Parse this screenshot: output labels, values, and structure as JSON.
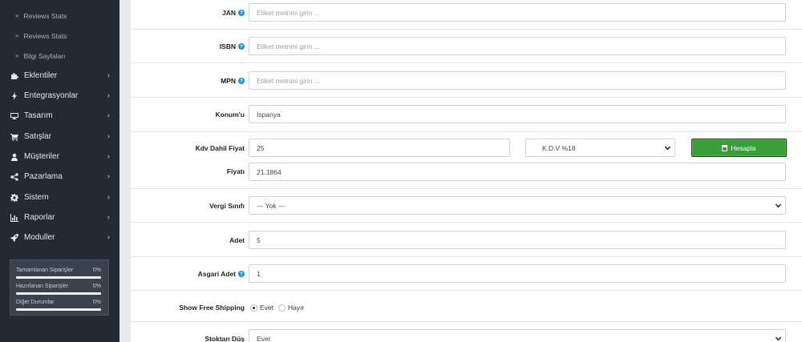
{
  "sidebar": {
    "sub_items": [
      {
        "label": "Reviews Stats"
      },
      {
        "label": "Reviews Stats"
      },
      {
        "label": "Bilgi Sayfaları"
      }
    ],
    "nav_items": [
      {
        "label": "Eklentiler",
        "icon": "puzzle-icon"
      },
      {
        "label": "Entegrasyonlar",
        "icon": "bolt-icon"
      },
      {
        "label": "Tasarım",
        "icon": "monitor-icon"
      },
      {
        "label": "Satışlar",
        "icon": "cart-icon"
      },
      {
        "label": "Müşteriler",
        "icon": "user-icon"
      },
      {
        "label": "Pazarlama",
        "icon": "share-icon"
      },
      {
        "label": "Sistem",
        "icon": "gear-icon"
      },
      {
        "label": "Raporlar",
        "icon": "chart-icon"
      },
      {
        "label": "Moduller",
        "icon": "rocket-icon"
      }
    ],
    "stats": [
      {
        "label": "Tamamlanan Siparişler",
        "value": "0%",
        "progress": 0
      },
      {
        "label": "Hazırlanan Siparişler",
        "value": "0%",
        "progress": 0
      },
      {
        "label": "Diğer Durumlar",
        "value": "0%",
        "progress": 0
      }
    ]
  },
  "form": {
    "jan": {
      "label": "JAN",
      "placeholder": "Etiket metnini girin ..."
    },
    "isbn": {
      "label": "ISBN",
      "placeholder": "Etiket metnini girin ..."
    },
    "mpn": {
      "label": "MPN",
      "placeholder": "Etiket metnini girin ..."
    },
    "location": {
      "label": "Konum'u",
      "value": "İspanya"
    },
    "price_incl_vat": {
      "label": "Kdv Dahil Fiyat",
      "value": "25"
    },
    "vat_select": {
      "value": "K.D.V %18"
    },
    "calculate_button": {
      "label": "Hesapla"
    },
    "price": {
      "label": "Fiyatı",
      "value": "21.1864"
    },
    "tax_class": {
      "label": "Vergi Sınıfı",
      "value": "--- Yok ---"
    },
    "quantity": {
      "label": "Adet",
      "value": "5"
    },
    "minimum": {
      "label": "Asgari Adet",
      "value": "1"
    },
    "free_shipping": {
      "label": "Show Free Shipping",
      "options": [
        "Evet",
        "Hayır"
      ],
      "selected": "Evet"
    },
    "subtract_stock": {
      "label": "Stoktan Düş",
      "value": "Evet"
    }
  },
  "colors": {
    "sidebar_bg": "#232a33",
    "accent_blue": "#1e91cf",
    "button_green": "#3a9d3a"
  }
}
